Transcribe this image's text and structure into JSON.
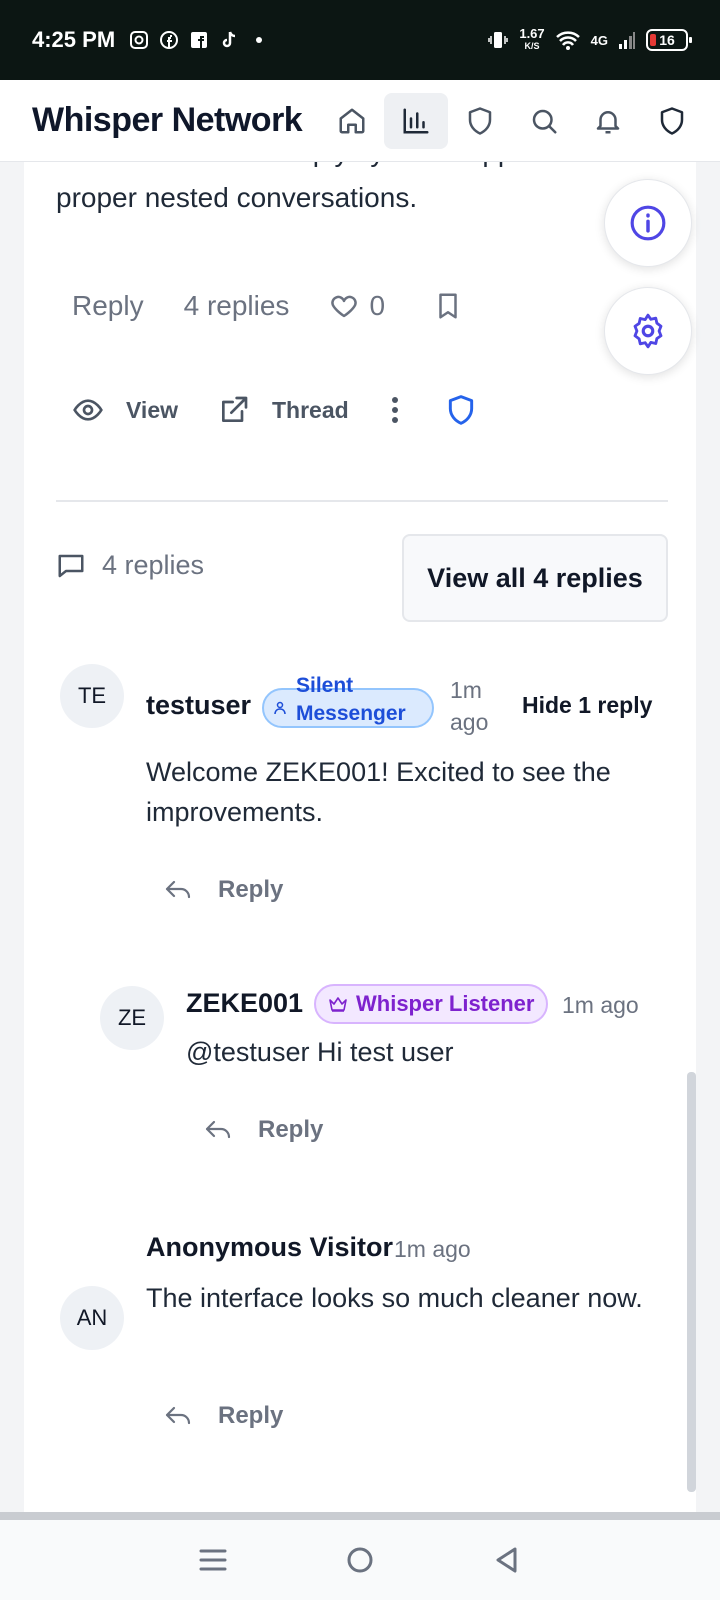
{
  "status_bar": {
    "time": "4:25 PM",
    "speed_value": "1.67",
    "speed_unit": "K/S",
    "network": "4G",
    "battery": "16"
  },
  "header": {
    "brand": "Whisper Network",
    "nav_icons": [
      "home-icon",
      "chart-icon",
      "shield-icon",
      "search-icon",
      "bell-icon",
      "shield-icon"
    ],
    "active_nav": "chart-icon"
  },
  "post": {
    "text_clipped": "Network! Our new reply system supports",
    "text_line2": "proper nested conversations.",
    "reply_label": "Reply",
    "replies_label": "4 replies",
    "likes": "0",
    "view_label": "View",
    "thread_label": "Thread"
  },
  "replies_section": {
    "count_label": "4 replies",
    "view_all_label": "View all 4 replies"
  },
  "comments": [
    {
      "initials": "TE",
      "username": "testuser",
      "badge_line1": "Silent",
      "badge_line2": "Messenger",
      "time_line1": "1m",
      "time_line2": "ago",
      "hide_label": "Hide 1 reply",
      "text": "Welcome ZEKE001! Excited to see the improvements.",
      "reply_label": "Reply"
    },
    {
      "initials": "ZE",
      "username": "ZEKE001",
      "badge": "Whisper Listener",
      "time": "1m ago",
      "text": "@testuser Hi test user",
      "reply_label": "Reply"
    },
    {
      "initials": "AN",
      "username": "Anonymous Visitor",
      "time": "1m ago",
      "text": "The interface looks so much cleaner now.",
      "reply_label": "Reply"
    }
  ],
  "colors": {
    "accent_blue": "#4f46e5",
    "shield_blue": "#2563eb",
    "badge_blue_bg": "#dbeafe",
    "badge_purple_bg": "#f3e8ff"
  }
}
